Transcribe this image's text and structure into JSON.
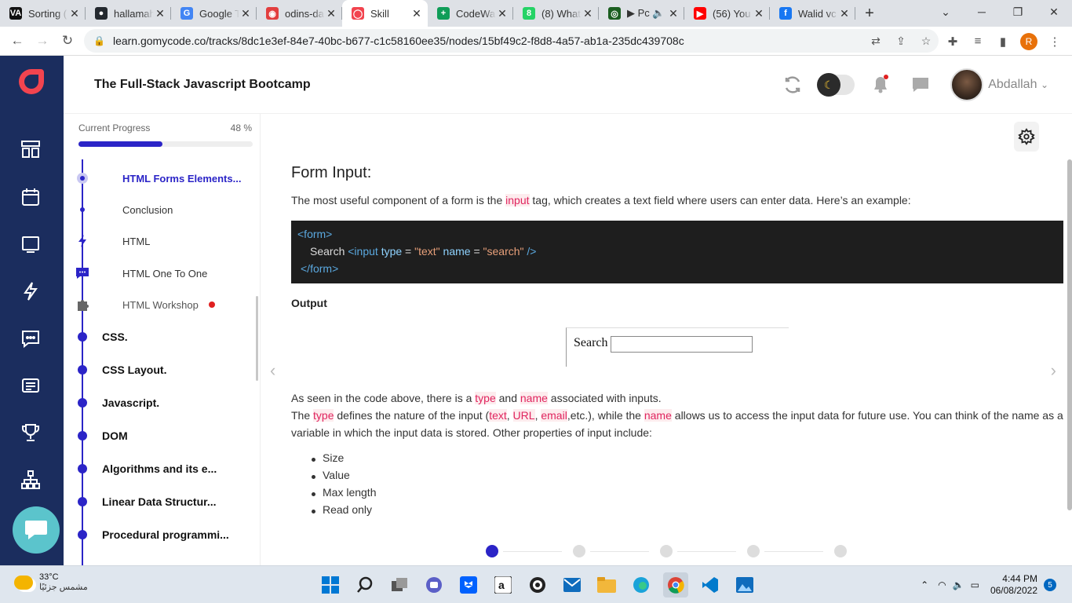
{
  "browser": {
    "tabs": [
      {
        "title": "Sorting (",
        "color": "#111",
        "glyph": "VA"
      },
      {
        "title": "hallamah",
        "color": "#24292f",
        "glyph": "●"
      },
      {
        "title": "Google T",
        "color": "#4285f4",
        "glyph": "G"
      },
      {
        "title": "odins-da",
        "color": "#e23e3e",
        "glyph": "◉"
      },
      {
        "title": "Skill",
        "color": "#f2444f",
        "glyph": "◯"
      },
      {
        "title": "CodeWa",
        "color": "#0f9d58",
        "glyph": "+"
      },
      {
        "title": "(8) What",
        "color": "#25d366",
        "glyph": "8"
      },
      {
        "title": "▶ Pc 🔈",
        "color": "#1b5e20",
        "glyph": "◎"
      },
      {
        "title": "(56) You",
        "color": "#ff0000",
        "glyph": "▶"
      },
      {
        "title": "Walid vc",
        "color": "#1877f2",
        "glyph": "f"
      }
    ],
    "active_tab": 4,
    "new_tab": "+",
    "url": "learn.gomycode.co/tracks/8dc1e3ef-84e7-40bc-b677-c1c58160ee35/nodes/15bf49c2-f8d8-4a57-ab1a-235dc439708c",
    "profile_initial": "R"
  },
  "header": {
    "course_title": "The Full-Stack Javascript Bootcamp",
    "user_name": "Abdallah"
  },
  "progress": {
    "label": "Current Progress",
    "percent_text": "48 %",
    "percent": 48
  },
  "lessons": [
    {
      "label": "HTML Forms Elements...",
      "state": "selected"
    },
    {
      "label": "Conclusion",
      "state": "dot"
    },
    {
      "label": "HTML",
      "state": "bolt"
    },
    {
      "label": "HTML One To One",
      "state": "chat"
    },
    {
      "label": "HTML Workshop",
      "state": "puzzle"
    }
  ],
  "sections": [
    "CSS.",
    "CSS Layout.",
    "Javascript.",
    "DOM",
    "Algorithms and its e...",
    "Linear Data Structur...",
    "Procedural programmi..."
  ],
  "content": {
    "title": "Form Input:",
    "intro_pre": "The most useful component of a form is the ",
    "intro_hl": "input",
    "intro_post": " tag, which creates a text field where users can enter data. Here’s an example:",
    "code": {
      "line1_open": "<form>",
      "line2_text": "Search ",
      "line2_tag": "<input",
      "line2_attr1": "type",
      "line2_eq1": " = ",
      "line2_val1": "\"text\"",
      "line2_attr2": "name",
      "line2_eq2": " = ",
      "line2_val2": "\"search\"",
      "line2_close": " />",
      "line3_close": "</form>"
    },
    "output_label": "Output",
    "demo_label": "Search",
    "p2_a": "As seen in the code above, there is a ",
    "p2_type": "type",
    "p2_and": " and ",
    "p2_name": "name",
    "p2_b": " associated with inputs.",
    "p3_a": "The ",
    "p3_type": "type",
    "p3_b": " defines the nature of the input (",
    "p3_text": "text",
    "p3_comma1": ", ",
    "p3_url": "URL",
    "p3_comma2": ", ",
    "p3_email": "email",
    "p3_c": ",etc.), while the ",
    "p3_name": "name",
    "p3_d": " allows us to access the input data for future use. You can think of the name as a",
    "p3_e": "variable in which the input data is stored. Other properties of input include:",
    "properties": [
      "Size",
      "Value",
      "Max length",
      "Read only"
    ],
    "pages_total": 5,
    "page_current": 1
  },
  "taskbar": {
    "temp": "33°C",
    "weather_text": "مشمس جزئيًا",
    "time": "4:44 PM",
    "date": "06/08/2022",
    "notifications": "5"
  }
}
